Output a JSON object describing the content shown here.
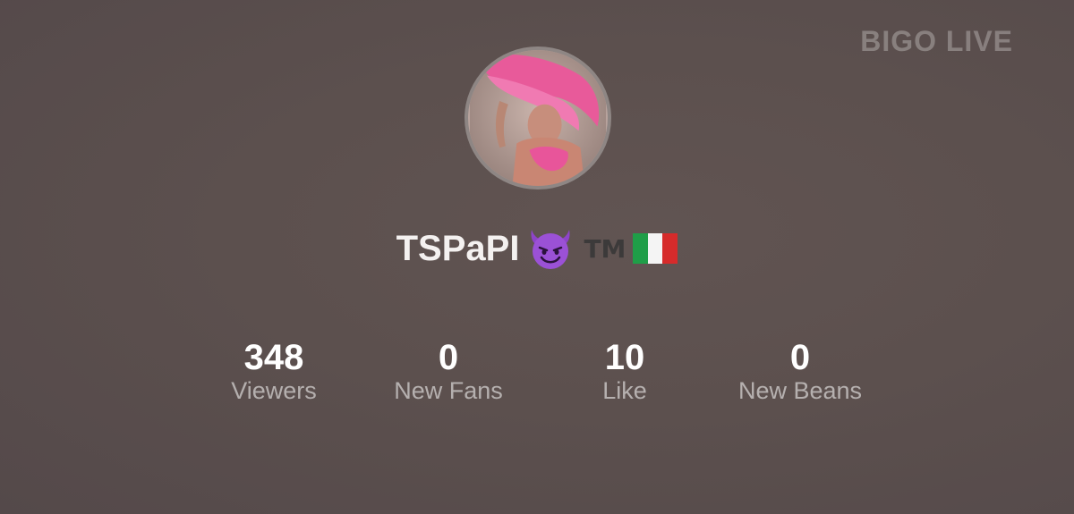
{
  "watermark": "BIGO LIVE",
  "profile": {
    "name": "TSPaPI",
    "badge": "devil-emoji",
    "trademark": "TM",
    "flag": "italy-flag-emoji"
  },
  "stats": [
    {
      "value": "348",
      "label": "Viewers"
    },
    {
      "value": "0",
      "label": "New Fans"
    },
    {
      "value": "10",
      "label": "Like"
    },
    {
      "value": "0",
      "label": "New Beans"
    }
  ],
  "colors": {
    "background": "#5c504e",
    "avatar_border": "#8e8684",
    "text_primary": "#ffffff",
    "text_secondary": "#bdb6b5"
  }
}
